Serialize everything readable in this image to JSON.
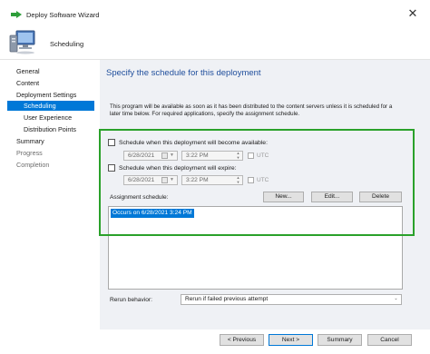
{
  "window": {
    "title": "Deploy Software Wizard",
    "close_label": "✕"
  },
  "header": {
    "step_title": "Scheduling"
  },
  "nav": {
    "items": [
      {
        "label": "General"
      },
      {
        "label": "Content"
      },
      {
        "label": "Deployment Settings"
      },
      {
        "label": "Scheduling"
      },
      {
        "label": "User Experience"
      },
      {
        "label": "Distribution Points"
      },
      {
        "label": "Summary"
      },
      {
        "label": "Progress"
      },
      {
        "label": "Completion"
      }
    ]
  },
  "main": {
    "heading": "Specify the schedule for this deployment",
    "description": "This program will be available as soon as it has been distributed to the content servers unless it is scheduled for a later time below. For required applications, specify the assignment schedule.",
    "available": {
      "label": "Schedule when this deployment will become available:",
      "checked": false,
      "date": "6/28/2021",
      "time": "3:22 PM",
      "utc_label": "UTC"
    },
    "expire": {
      "label": "Schedule when this deployment will expire:",
      "checked": false,
      "date": "6/28/2021",
      "time": "3:22 PM",
      "utc_label": "UTC"
    },
    "assignment": {
      "label": "Assignment schedule:",
      "new_label": "New...",
      "edit_label": "Edit...",
      "delete_label": "Delete",
      "entries": [
        "Occurs on 6/28/2021 3:24 PM"
      ]
    },
    "rerun": {
      "label": "Rerun behavior:",
      "value": "Rerun if failed previous attempt"
    }
  },
  "footer": {
    "previous_label": "< Previous",
    "next_label": "Next >",
    "summary_label": "Summary",
    "cancel_label": "Cancel"
  },
  "colors": {
    "accent": "#0078d7",
    "heading": "#1f4e9c",
    "highlight": "#2aa12a",
    "panel_bg": "#eff1f5"
  }
}
